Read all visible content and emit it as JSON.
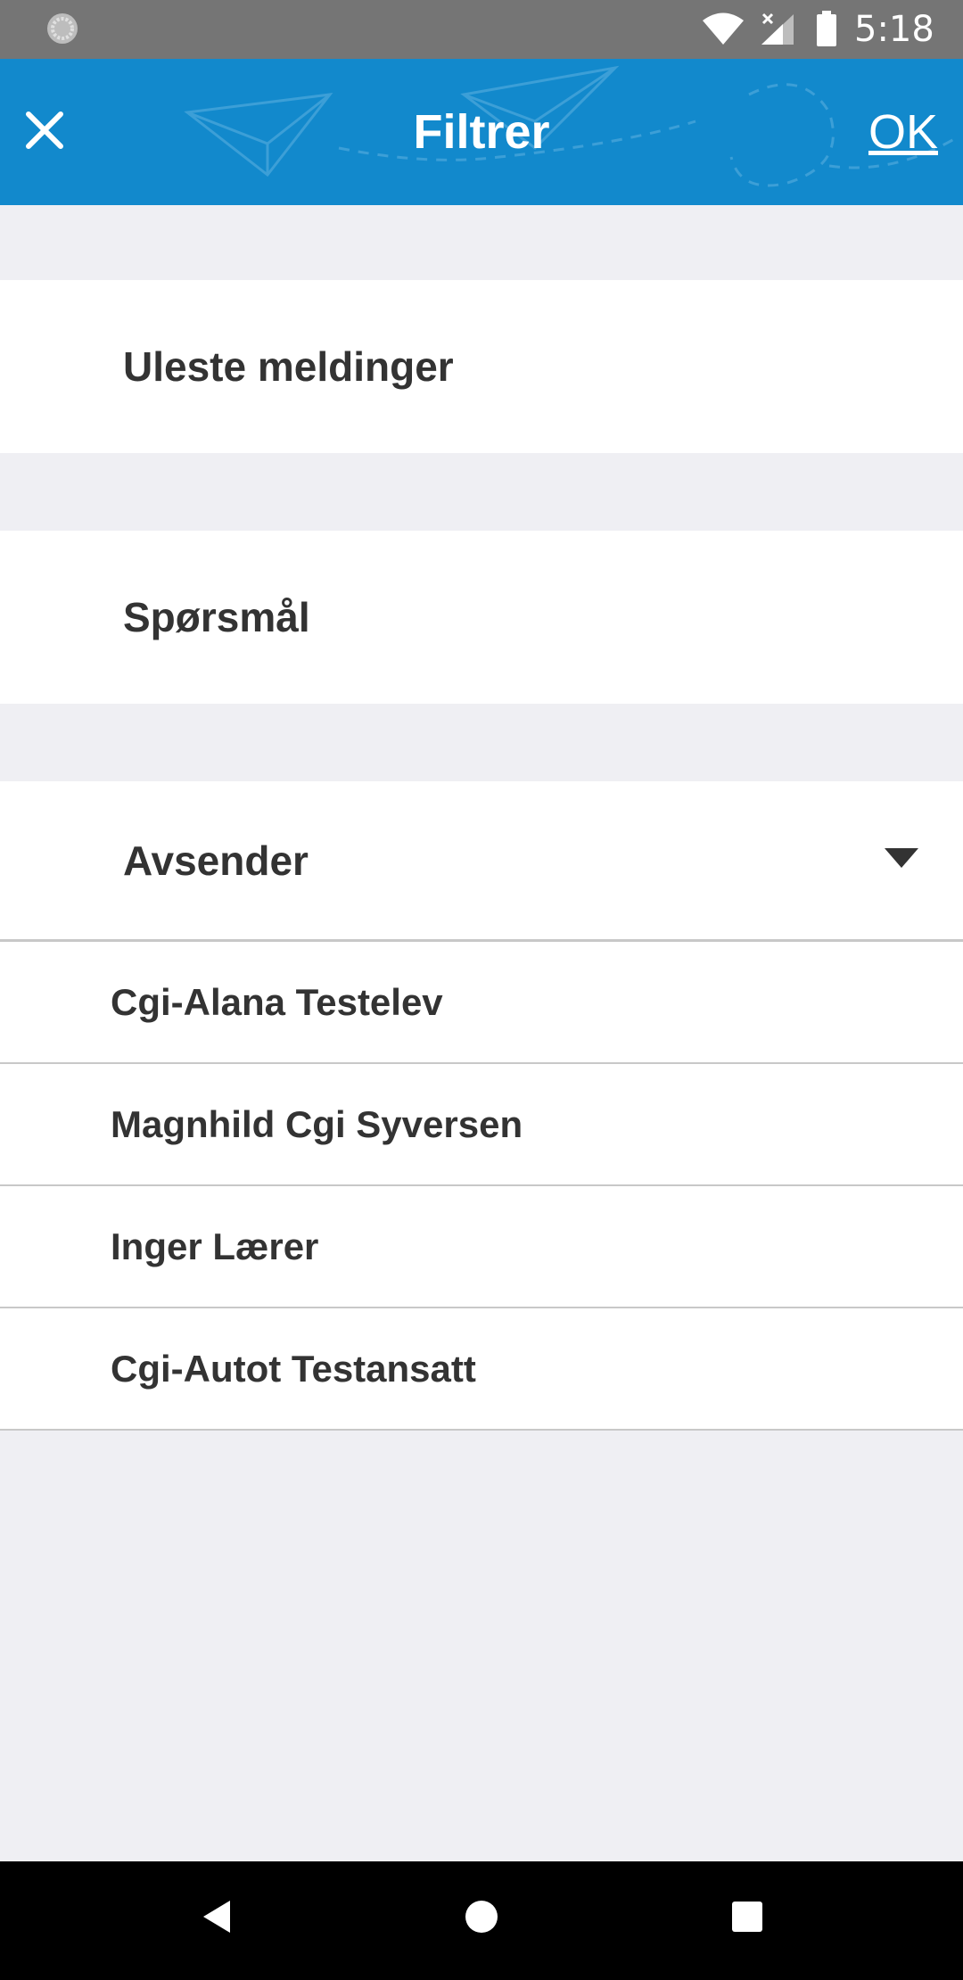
{
  "status_bar": {
    "time": "5:18",
    "icons": [
      "sync-icon",
      "wifi-icon",
      "signal-icon",
      "battery-icon"
    ]
  },
  "header": {
    "title": "Filtrer",
    "ok_label": "OK",
    "close_icon": "close-icon",
    "background_color": "#1289cc"
  },
  "filters": {
    "unread_label": "Uleste meldinger",
    "questions_label": "Spørsmål",
    "sender_label": "Avsender",
    "sender_icon": "chevron-down-icon"
  },
  "senders": [
    {
      "name": "Cgi-Alana Testelev"
    },
    {
      "name": "Magnhild Cgi Syversen"
    },
    {
      "name": "Inger Lærer"
    },
    {
      "name": "Cgi-Autot Testansatt"
    }
  ],
  "nav_bar": {
    "icons": [
      "back-icon",
      "home-icon",
      "recents-icon"
    ]
  }
}
